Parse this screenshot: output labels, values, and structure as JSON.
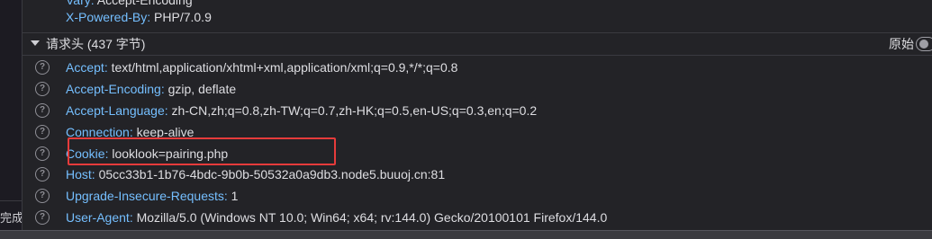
{
  "left_status": "完成",
  "response_headers_tail": [
    {
      "name": "Vary",
      "value": "Accept-Encoding"
    },
    {
      "name": "X-Powered-By",
      "value": "PHP/7.0.9"
    }
  ],
  "request_section": {
    "title": "请求头 (437 字节)",
    "raw_label": "原始"
  },
  "request_headers": [
    {
      "name": "Accept",
      "value": "text/html,application/xhtml+xml,application/xml;q=0.9,*/*;q=0.8"
    },
    {
      "name": "Accept-Encoding",
      "value": "gzip, deflate"
    },
    {
      "name": "Accept-Language",
      "value": "zh-CN,zh;q=0.8,zh-TW;q=0.7,zh-HK;q=0.5,en-US;q=0.3,en;q=0.2"
    },
    {
      "name": "Connection",
      "value": "keep-alive"
    },
    {
      "name": "Cookie",
      "value": "looklook=pairing.php"
    },
    {
      "name": "Host",
      "value": "05cc33b1-1b76-4bdc-9b0b-50532a0a9db3.node5.buuoj.cn:81"
    },
    {
      "name": "Upgrade-Insecure-Requests",
      "value": "1"
    },
    {
      "name": "User-Agent",
      "value": "Mozilla/5.0 (Windows NT 10.0; Win64; x64; rv:144.0) Gecko/20100101 Firefox/144.0"
    }
  ],
  "colors": {
    "background": "#232327",
    "header_name": "#75bfff",
    "header_value": "#dedee2",
    "highlight_box": "#e63b3b"
  },
  "icons": {
    "help": "question-circle-icon",
    "twisty": "triangle-down-icon",
    "toggle": "toggle-switch-icon"
  }
}
